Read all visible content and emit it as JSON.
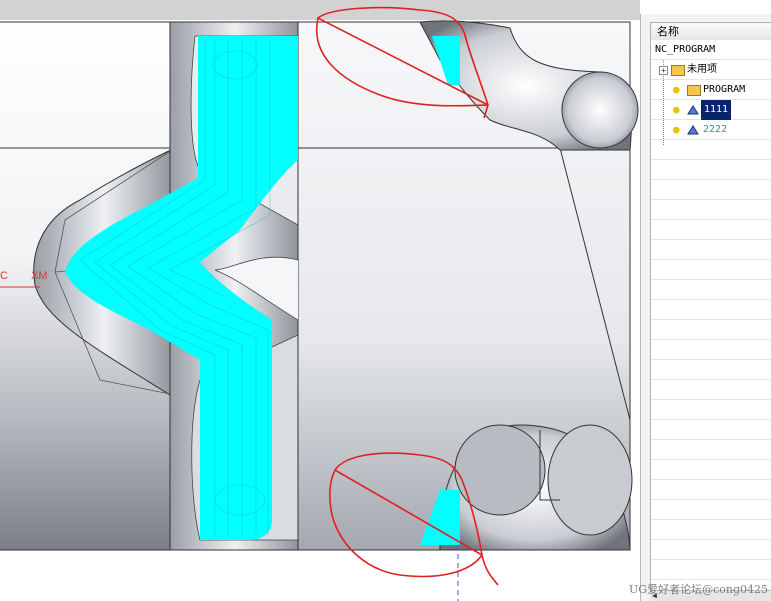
{
  "navigator": {
    "header": "名称",
    "root": "NC_PROGRAM",
    "items": [
      {
        "label": "未用项",
        "icon": "folder-icon",
        "expander": "+"
      },
      {
        "label": "PROGRAM",
        "icon": "program-folder-icon"
      },
      {
        "label": "1111",
        "icon": "operation-icon",
        "selected": true
      },
      {
        "label": "2222",
        "icon": "operation-icon"
      }
    ]
  },
  "viewport": {
    "axis_labels": {
      "c": "C",
      "xm": "XM"
    },
    "toolpath_color": "#00ffff",
    "markup_color": "#e02020"
  },
  "watermark": "UG爱好者论坛@cong0425"
}
